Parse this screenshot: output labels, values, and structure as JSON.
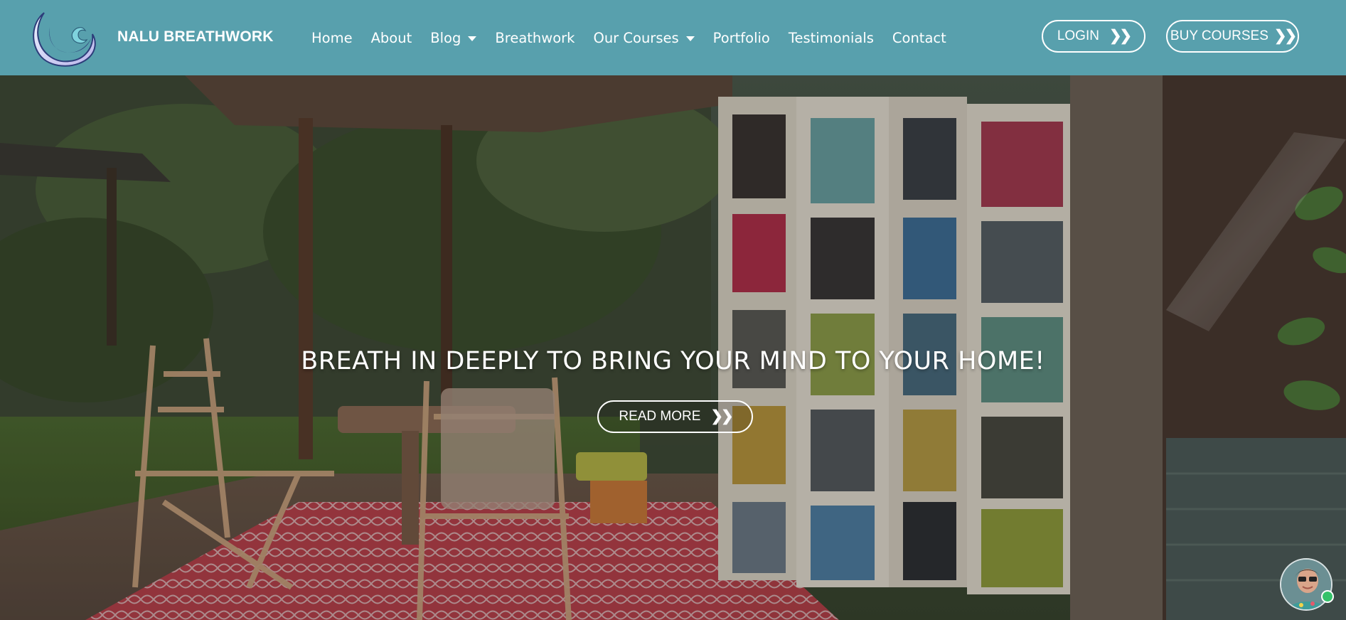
{
  "header": {
    "brand_name": "NALU BREATHWORK",
    "logo_icon": "moon-wave-logo",
    "background_color": "#58a0ad",
    "nav": [
      {
        "label": "Home"
      },
      {
        "label": "About"
      },
      {
        "label": "Blog",
        "has_dropdown": true
      },
      {
        "label": "Breathwork"
      },
      {
        "label": "Our Courses",
        "has_dropdown": true
      },
      {
        "label": "Portfolio"
      },
      {
        "label": "Testimonials"
      },
      {
        "label": "Contact"
      }
    ],
    "login_label": "LOGIN",
    "buy_courses_label": "BUY COURSES",
    "button_icon": "double-chevron-right-icon"
  },
  "hero": {
    "headline": "BREATH IN DEEPLY TO BRING YOUR MIND TO YOUR HOME!",
    "read_more_label": "READ MORE"
  },
  "chat_widget": {
    "avatar_icon": "chat-avatar",
    "status_color": "#35c26a"
  }
}
